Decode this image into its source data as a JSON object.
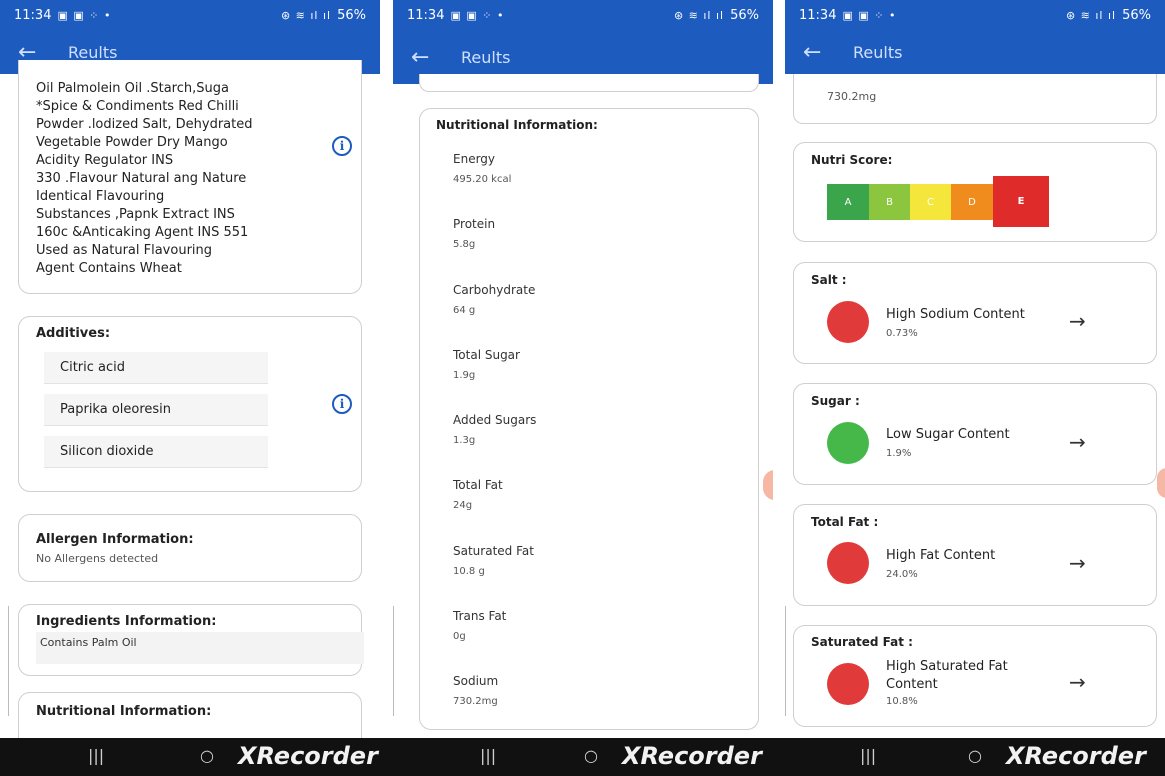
{
  "status": {
    "time": "11:34",
    "battery": "56%",
    "glyphs": "▣ ▣ ⁘ •",
    "network": "⊛ ≋ ıl ıl"
  },
  "appbar": {
    "title": "Reults",
    "back_glyph": "←"
  },
  "panel1": {
    "ingredients_lines": [
      "Oil Palmolein Oil .Starch,Suga",
      "*Spice & Condiments Red Chilli",
      "Powder .lodized Salt, Dehydrated",
      "Vegetable Powder Dry Mango",
      "Acidity Regulator INS",
      "330 .Flavour Natural ang Nature",
      "Identical Flavouring",
      "Substances ,Papnk Extract INS",
      "160c &Anticaking Agent INS 551",
      "Used as Natural Flavouring",
      "Agent Contains Wheat"
    ],
    "additives": {
      "title": "Additives:",
      "items": [
        "Citric acid",
        "Paprika oleoresin",
        "Silicon dioxide"
      ]
    },
    "allergen": {
      "title": "Allergen Information:",
      "text": "No Allergens detected"
    },
    "ingredients_info": {
      "title": "Ingredients Information:",
      "text": "Contains Palm Oil"
    },
    "nutritional_title": "Nutritional Information:"
  },
  "panel2": {
    "title": "Nutritional Information:",
    "items": [
      {
        "label": "Energy",
        "value": "495.20 kcal"
      },
      {
        "label": "Protein",
        "value": "5.8g"
      },
      {
        "label": "Carbohydrate",
        "value": "64 g"
      },
      {
        "label": "Total Sugar",
        "value": "1.9g"
      },
      {
        "label": "Added Sugars",
        "value": "1.3g"
      },
      {
        "label": "Total Fat",
        "value": "24g"
      },
      {
        "label": "Saturated Fat",
        "value": "10.8 g"
      },
      {
        "label": "Trans Fat",
        "value": "0g"
      },
      {
        "label": "Sodium",
        "value": "730.2mg"
      }
    ]
  },
  "panel3": {
    "sodium_value": "730.2mg",
    "nutri_score": {
      "title": "Nutri Score:",
      "grades": [
        "A",
        "B",
        "C",
        "D",
        "E"
      ],
      "selected": "E",
      "colors": [
        "#3aa54a",
        "#8cc63f",
        "#f5e63b",
        "#f08c1e",
        "#e02b2b"
      ]
    },
    "salt": {
      "title": "Salt :",
      "label": "High Sodium Content",
      "value": "0.73%",
      "color": "#e03a3a"
    },
    "sugar": {
      "title": "Sugar :",
      "label": "Low Sugar Content",
      "value": "1.9%",
      "color": "#46b84a"
    },
    "total_fat": {
      "title": "Total Fat :",
      "label": "High Fat Content",
      "value": "24.0%",
      "color": "#e03a3a"
    },
    "saturated_fat": {
      "title": "Saturated Fat :",
      "label_line1": "High Saturated Fat",
      "label_line2": "Content",
      "value": "10.8%",
      "color": "#e03a3a"
    }
  },
  "navbar": {
    "recents": "|||",
    "home": "○",
    "watermark": "XRecorder"
  }
}
